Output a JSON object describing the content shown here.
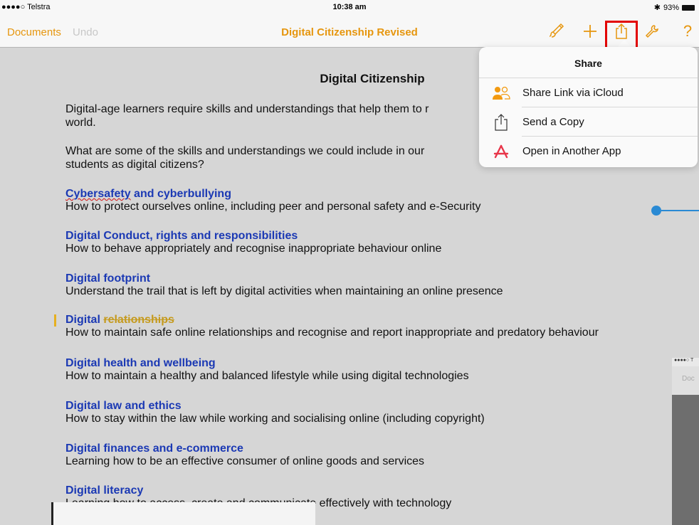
{
  "status": {
    "carrier": "●●●●○ Telstra",
    "time": "10:38 am",
    "battery": "93%"
  },
  "nav": {
    "back_label": "Documents",
    "undo_label": "Undo",
    "title": "Digital Citizenship Revised",
    "icons": [
      "paintbrush-icon",
      "plus-icon",
      "share-icon",
      "wrench-icon",
      "help-icon"
    ]
  },
  "document": {
    "title": "Digital Citizenship",
    "intro1_line1": "Digital-age learners require skills and understandings that help them to r",
    "intro1_line2": "world.",
    "intro2_line1": "What are some of the skills and understandings we could include in our",
    "intro2_line2": "students as digital citizens?",
    "sections": [
      {
        "head_a": "Cybersafety",
        "head_b": " and cyberbullying",
        "sub": "How to protect ourselves online, including peer and personal safety and e-Security"
      },
      {
        "head": "Digital Conduct, rights and responsibilities",
        "sub": "How to behave appropriately and recognise inappropriate behaviour online"
      },
      {
        "head": "Digital footprint",
        "sub": "Understand the trail that is left by digital activities when maintaining an online presence"
      },
      {
        "head_a": "Digital ",
        "head_b": "relationships ",
        "sub": "How to maintain safe online relationships and recognise and report inappropriate and predatory behaviour"
      },
      {
        "head": "Digital health and wellbeing",
        "sub": "How to maintain a healthy and balanced lifestyle while using digital technologies"
      },
      {
        "head": "Digital law and ethics",
        "sub": "How to stay within the law while working and socialising online (including copyright)"
      },
      {
        "head": "Digital finances and e-commerce",
        "sub": "Learning how to be an effective consumer of online goods and services"
      },
      {
        "head": "Digital literacy",
        "sub": "Learning how to access, create and communicate effectively with technology"
      }
    ]
  },
  "thumbnail": {
    "status": "●●●●○ T",
    "nav": "Doc"
  },
  "share_popover": {
    "title": "Share",
    "items": [
      {
        "label": "Share Link via iCloud",
        "icon": "people-icon"
      },
      {
        "label": "Send a Copy",
        "icon": "share-box-icon"
      },
      {
        "label": "Open in Another App",
        "icon": "app-store-icon"
      }
    ]
  },
  "colors": {
    "accent": "#e6960e",
    "heading": "#1b39b4",
    "highlight": "#e30000",
    "comment": "#2a8ad4"
  }
}
